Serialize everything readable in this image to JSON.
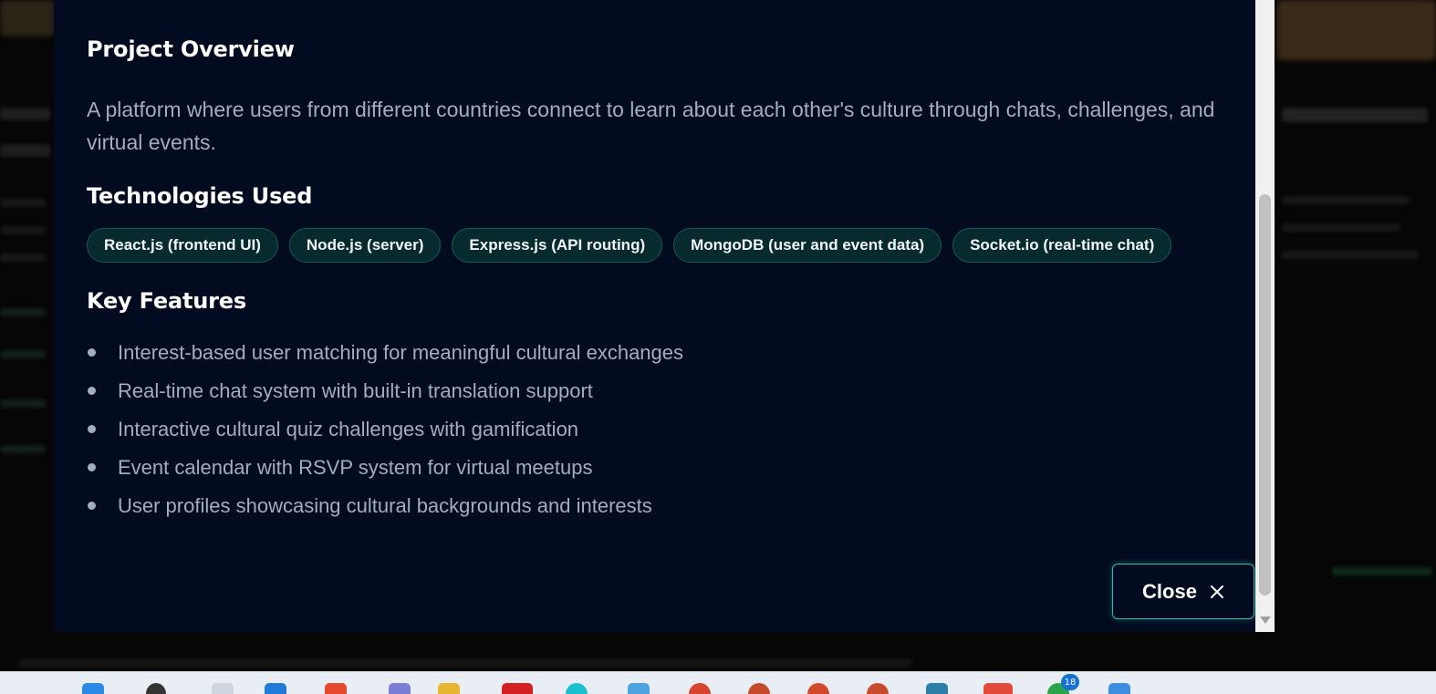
{
  "modal": {
    "overview_title": "Project Overview",
    "overview_text": "A platform where users from different countries connect to learn about each other's culture through chats, challenges, and virtual events.",
    "tech_title": "Technologies Used",
    "technologies": [
      "React.js (frontend UI)",
      "Node.js (server)",
      "Express.js (API routing)",
      "MongoDB (user and event data)",
      "Socket.io (real-time chat)"
    ],
    "features_title": "Key Features",
    "features": [
      "Interest-based user matching for meaningful cultural exchanges",
      "Real-time chat system with built-in translation support",
      "Interactive cultural quiz challenges with gamification",
      "Event calendar with RSVP system for virtual meetups",
      "User profiles showcasing cultural backgrounds and interests"
    ],
    "close_label": "Close",
    "close_icon": "close-x-icon"
  },
  "taskbar": {
    "badges": [
      "18"
    ]
  },
  "colors": {
    "modal_bg": "#020b1f",
    "accent": "#2cc1b4",
    "tag_bg": "#062a2d",
    "body_text": "#a3adbd"
  }
}
